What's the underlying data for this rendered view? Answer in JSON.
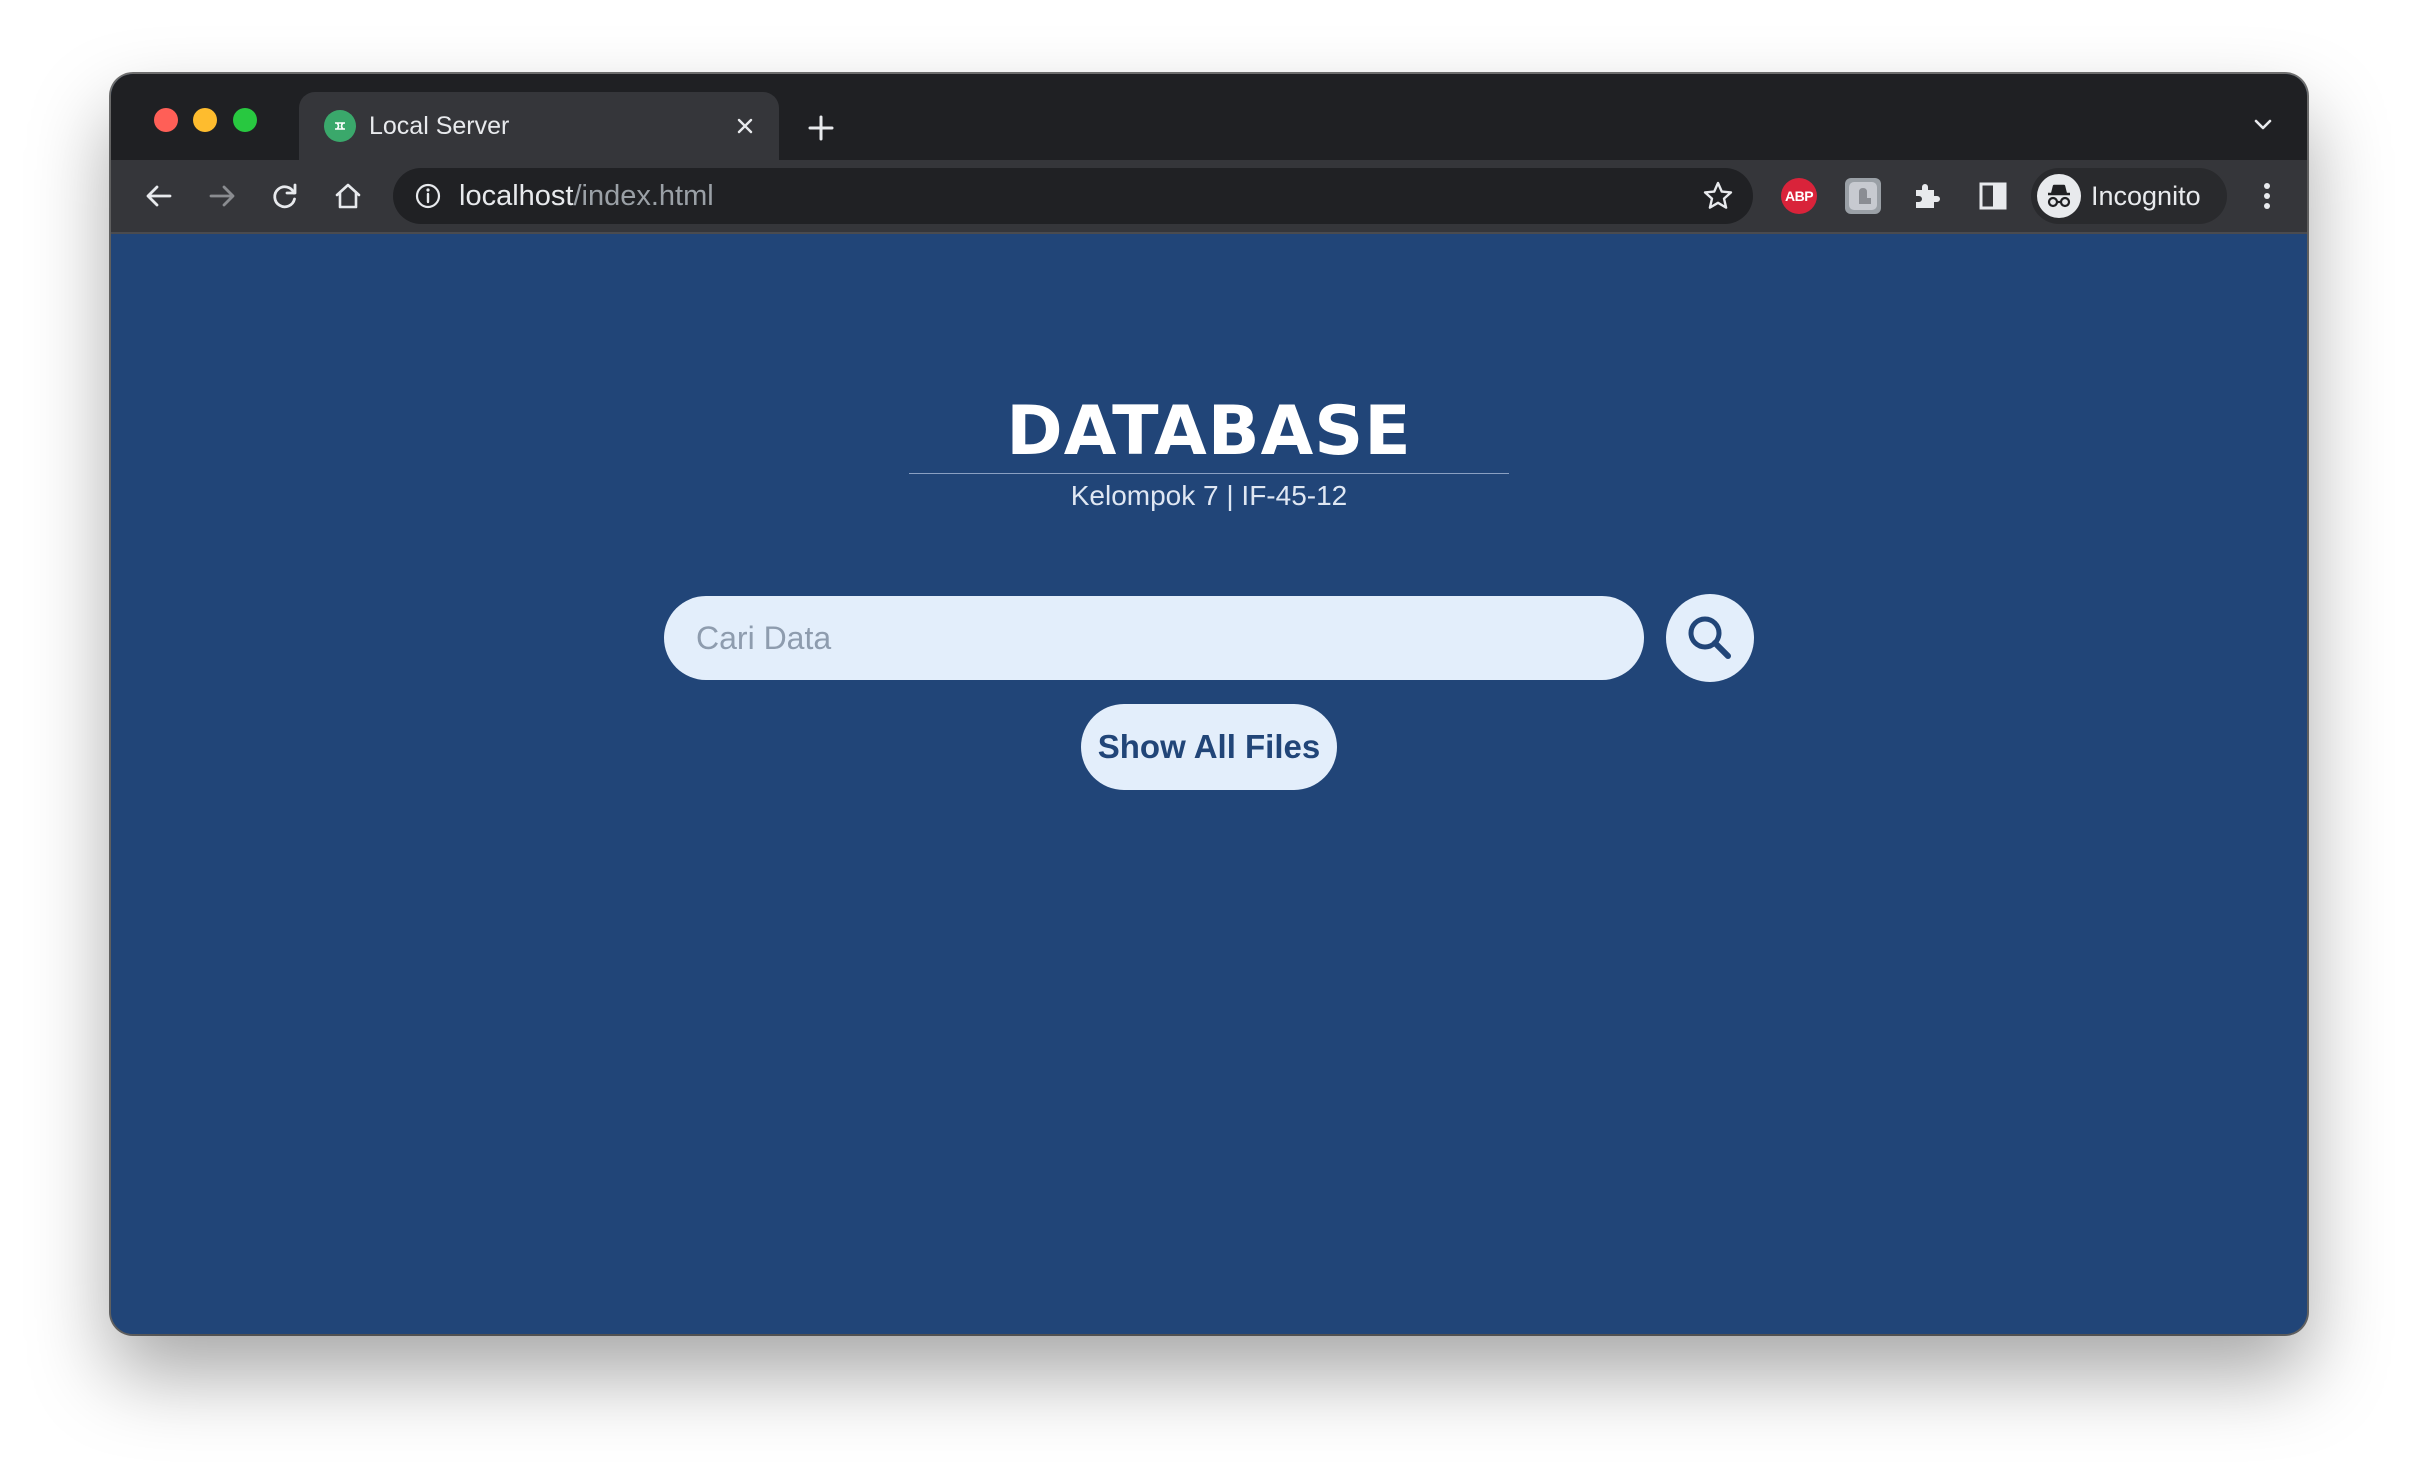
{
  "browser": {
    "tab": {
      "title": "Local Server"
    },
    "address_bar": {
      "host": "localhost",
      "path": "/index.html"
    },
    "extensions": {
      "abp_label": "ABP"
    },
    "profile": {
      "label": "Incognito"
    }
  },
  "page": {
    "title": "DATABASE",
    "subtitle": "Kelompok 7 | IF-45-12",
    "search": {
      "placeholder": "Cari Data",
      "value": ""
    },
    "show_all_label": "Show All Files",
    "colors": {
      "background": "#214578",
      "control": "#e3eefb"
    }
  }
}
